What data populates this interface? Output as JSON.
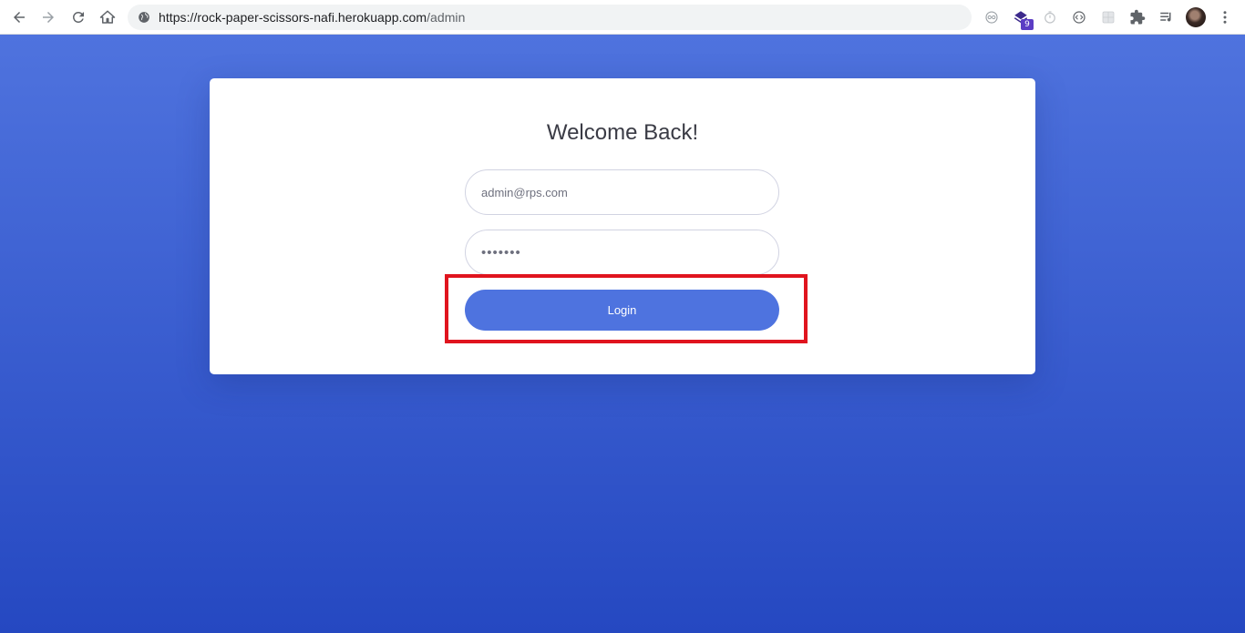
{
  "browser": {
    "url_host": "https://rock-paper-scissors-nafi.herokuapp.com",
    "url_path": "/admin",
    "extension_badge": "9",
    "icons": [
      "back-icon",
      "forward-icon",
      "reload-icon",
      "home-icon",
      "globe-icon",
      "extensions-icon",
      "media-icon",
      "menu-icon"
    ]
  },
  "login": {
    "title": "Welcome Back!",
    "email_value": "admin@rps.com",
    "password_value": "•••••••",
    "login_label": "Login"
  },
  "colors": {
    "page_gradient_top": "#4f73de",
    "page_gradient_bottom": "#2548c1",
    "button": "#4e73df",
    "highlight": "#e0141e"
  }
}
